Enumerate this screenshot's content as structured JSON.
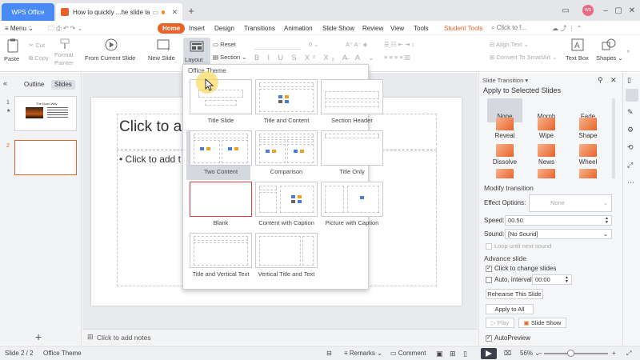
{
  "titlebar": {
    "app_tab": "WPS Office",
    "doc_tab": "How to quickly ...he slide layout",
    "avatar_text": "WS"
  },
  "menubar": {
    "menu_label": "Menu",
    "items": [
      "Home",
      "Insert",
      "Design",
      "Transitions",
      "Animation",
      "Slide Show",
      "Review",
      "View",
      "Tools",
      "Student Tools"
    ],
    "search_placeholder": "Click to f..."
  },
  "ribbon": {
    "cut": "Cut",
    "copy": "Copy",
    "paste": "Paste",
    "format_painter_1": "Format",
    "format_painter_2": "Painter",
    "from_current": "From Current Slide",
    "new_slide": "New Slide",
    "layout": "Layout",
    "reset": "Reset",
    "section": "Section",
    "font_size": "0",
    "align_text": "Align Text",
    "convert_smartart": "Convert To SmartArt",
    "text_box": "Text Box",
    "shapes": "Shapes"
  },
  "left_panel": {
    "tab_outline": "Outline",
    "tab_slides": "Slides",
    "slide1_num": "1",
    "slide1_star": "★",
    "slide2_num": "2",
    "slide1_title": "The Road Way"
  },
  "slide": {
    "title_placeholder": "Click to ad",
    "body_placeholder": "• Click to add t"
  },
  "notes": {
    "placeholder": "Click to add notes"
  },
  "layout_dropdown": {
    "header": "Office Theme",
    "layouts": [
      {
        "label": "Title Slide"
      },
      {
        "label": "Title and Content"
      },
      {
        "label": "Section Header"
      },
      {
        "label": "Two Content"
      },
      {
        "label": "Comparison"
      },
      {
        "label": "Title Only"
      },
      {
        "label": "Blank"
      },
      {
        "label": "Content with Caption"
      },
      {
        "label": "Picture with Caption"
      },
      {
        "label": "Title and Vertical Text"
      },
      {
        "label": "Vertical Title and Text"
      }
    ]
  },
  "right_panel": {
    "title": "Slide Transition",
    "apply_to": "Apply to Selected Slides",
    "transitions": [
      "None",
      "Morph",
      "Fade",
      "Reveal",
      "Wipe",
      "Shape",
      "Dissolve",
      "News",
      "Wheel"
    ],
    "modify": "Modify transition",
    "effect_options_label": "Effect Options:",
    "effect_options_value": "None",
    "speed_label": "Speed:",
    "speed_value": "00.50",
    "sound_label": "Sound:",
    "sound_value": "[No Sound]",
    "loop_label": "Loop until next sound",
    "advance": "Advance slide",
    "click_to_change": "Click to change slides",
    "auto_interval": "Auto, interval:",
    "interval_value": "00:00",
    "rehearse": "Rehearse This Slide",
    "apply_all": "Apply to All",
    "play": "Play",
    "slide_show": "Slide Show",
    "autopreview": "AutoPreview"
  },
  "statusbar": {
    "slide_pos": "Slide 2 / 2",
    "theme": "Office Theme",
    "remarks": "Remarks",
    "comment": "Comment",
    "zoom": "56%"
  },
  "colors": {
    "accent": "#e8622a",
    "tab_blue": "#4a8af4",
    "highlight_red": "#e03a3a"
  }
}
